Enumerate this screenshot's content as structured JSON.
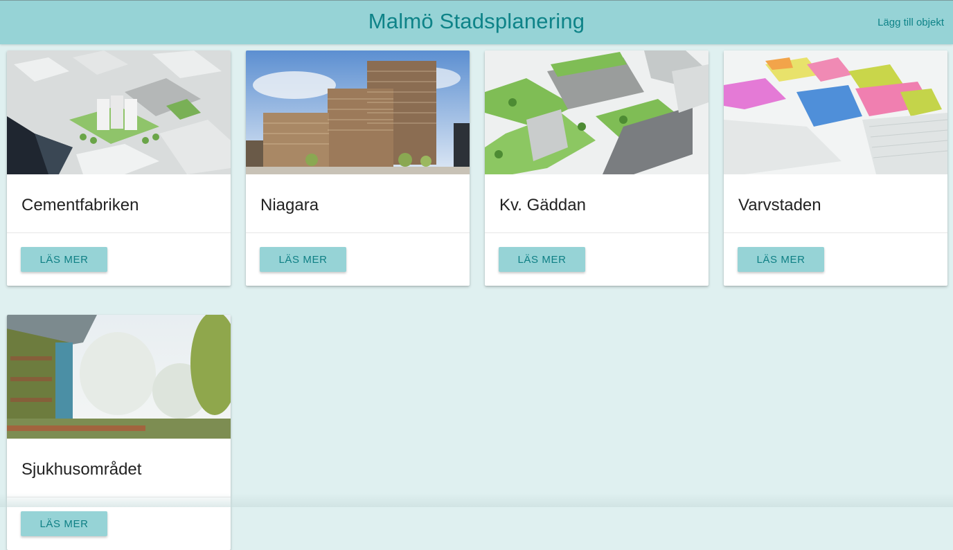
{
  "header": {
    "title": "Malmö Stadsplanering",
    "add_link": "Lägg till objekt"
  },
  "colors": {
    "accent": "#96d3d6",
    "accent_text": "#0e8388",
    "background": "#dff0f0"
  },
  "projects": [
    {
      "name": "Cementfabriken",
      "button": "LÄS MER"
    },
    {
      "name": "Niagara",
      "button": "LÄS MER"
    },
    {
      "name": "Kv. Gäddan",
      "button": "LÄS MER"
    },
    {
      "name": "Varvstaden",
      "button": "LÄS MER"
    },
    {
      "name": "Sjukhusområdet",
      "button": "LÄS MER"
    }
  ]
}
